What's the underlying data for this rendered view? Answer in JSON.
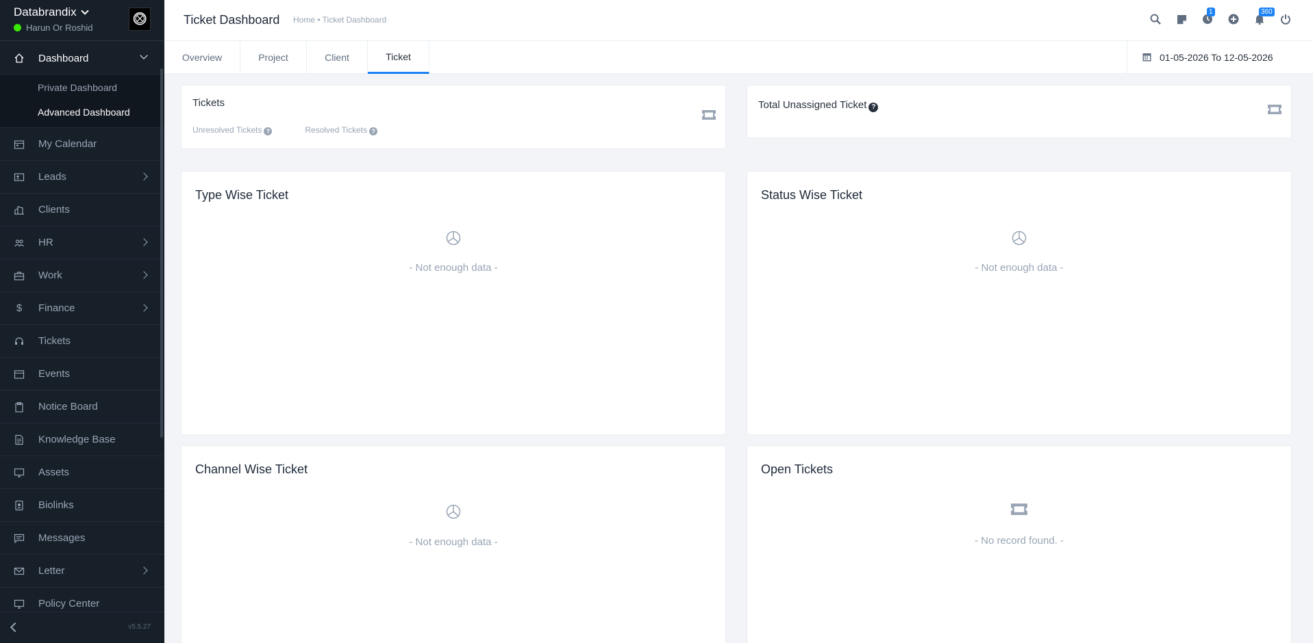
{
  "sidebar": {
    "company": "Databrandix",
    "user": "Harun Or Roshid",
    "version": "v5.5.27",
    "dashboard": {
      "label": "Dashboard",
      "sub": [
        "Private Dashboard",
        "Advanced Dashboard"
      ]
    },
    "items": [
      {
        "label": "My Calendar",
        "icon": "calendar-icon"
      },
      {
        "label": "Leads",
        "icon": "leads-icon"
      },
      {
        "label": "Clients",
        "icon": "clients-icon"
      },
      {
        "label": "HR",
        "icon": "hr-icon"
      },
      {
        "label": "Work",
        "icon": "work-icon"
      },
      {
        "label": "Finance",
        "icon": "finance-icon"
      },
      {
        "label": "Tickets",
        "icon": "headset-icon"
      },
      {
        "label": "Events",
        "icon": "events-icon"
      },
      {
        "label": "Notice Board",
        "icon": "clipboard-icon"
      },
      {
        "label": "Knowledge Base",
        "icon": "document-icon"
      },
      {
        "label": "Assets",
        "icon": "monitor-icon"
      },
      {
        "label": "Biolinks",
        "icon": "biolinks-icon"
      },
      {
        "label": "Messages",
        "icon": "messages-icon"
      },
      {
        "label": "Letter",
        "icon": "envelope-icon"
      },
      {
        "label": "Policy Center",
        "icon": "monitor-icon"
      }
    ]
  },
  "header": {
    "title": "Ticket Dashboard",
    "breadcrumb": "Home • Ticket Dashboard",
    "timer_badge": "1",
    "notif_badge": "360"
  },
  "tabs": [
    "Overview",
    "Project",
    "Client",
    "Ticket"
  ],
  "daterange": "01-05-2026 To 12-05-2026",
  "cards": {
    "tickets": {
      "title": "Tickets",
      "unresolved": "Unresolved Tickets",
      "resolved": "Resolved Tickets"
    },
    "unassigned": {
      "title": "Total Unassigned Ticket"
    },
    "type_wise": {
      "title": "Type Wise Ticket",
      "empty": "- Not enough data -"
    },
    "status_wise": {
      "title": "Status Wise Ticket",
      "empty": "- Not enough data -"
    },
    "channel_wise": {
      "title": "Channel Wise Ticket",
      "empty": "- Not enough data -"
    },
    "open": {
      "title": "Open Tickets",
      "empty": "- No record found. -"
    }
  },
  "colors": {
    "sidebar": "#171f29",
    "accent": "#1d82f5",
    "online": "#39e500"
  }
}
